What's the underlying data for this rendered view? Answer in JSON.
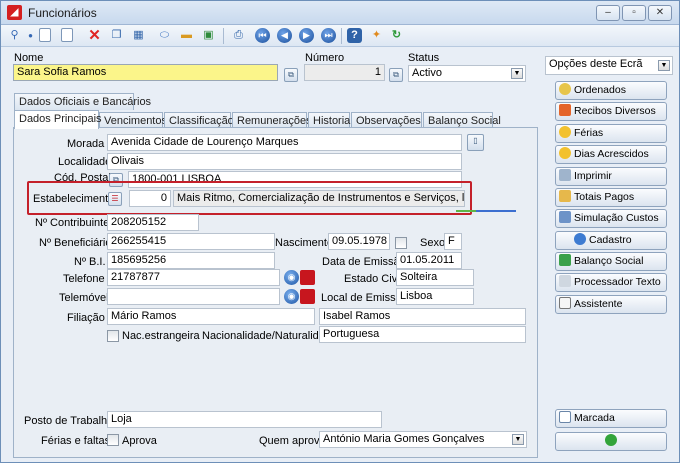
{
  "window": {
    "title": "Funcionários"
  },
  "toolbar": {
    "icons": [
      "search-icon",
      "new-icon",
      "document-icon",
      "delete-icon",
      "copy-icon",
      "table-icon",
      "link-icon",
      "folder-icon",
      "excel-icon",
      "preview-icon",
      "first-icon",
      "previous-icon",
      "next-icon",
      "last-icon",
      "help-icon",
      "tools-icon",
      "refresh-icon"
    ]
  },
  "header": {
    "nome_label": "Nome",
    "nome_value": "Sara Sofia Ramos",
    "numero_label": "Número",
    "numero_value": "1",
    "status_label": "Status",
    "status_value": "Activo"
  },
  "tabs_top": [
    "Dados Oficiais e Bancários"
  ],
  "tabs": [
    "Dados Principais",
    "Vencimentos",
    "Classificação",
    "Remunerações",
    "Historial",
    "Observações",
    "Balanço Social"
  ],
  "form": {
    "morada_label": "Morada",
    "morada_value": "Avenida Cidade de Lourenço Marques",
    "localidade_label": "Localidade",
    "localidade_value": "Olivais",
    "cod_postal_label": "Cód. Postal",
    "cod_postal_value": "1800-001 LISBOA",
    "estabelecimento_label": "Estabelecimento",
    "estabelecimento_num": "0",
    "estabelecimento_value": "Mais Ritmo, Comercialização de Instrumentos e Serviços, lda",
    "contribuinte_label": "Nº Contribuinte",
    "contribuinte_value": "208205152",
    "beneficiario_label": "Nº Beneficiário",
    "beneficiario_value": "266255415",
    "nascimento_label": "Nascimento",
    "nascimento_value": "09.05.1978",
    "sexo_label": "Sexo",
    "sexo_value": "F",
    "bi_label": "Nº B.I.",
    "bi_value": "185695256",
    "emissao_label": "Data de Emissão",
    "emissao_value": "01.05.2011",
    "telefone_label": "Telefone",
    "telefone_value": "21787877",
    "estado_civil_label": "Estado Civil",
    "estado_civil_value": "Solteira",
    "telemovel_label": "Telemóvel",
    "telemovel_value": "",
    "local_emissao_label": "Local de Emissão",
    "local_emissao_value": "Lisboa",
    "filiacao_label": "Filiação",
    "filiacao_pai": "Mário Ramos",
    "filiacao_mae": "Isabel Ramos",
    "nac_estrangeira_label": "Nac.estrangeira",
    "nacionalidade_label": "Nacionalidade/Naturalidade",
    "nacionalidade_value": "Portuguesa",
    "posto_label": "Posto de Trabalho",
    "posto_value": "Loja",
    "ferias_label": "Férias e faltas",
    "aprova_label": "Aprova",
    "quem_aprova_label": "Quem aprova",
    "quem_aprova_value": "António Maria Gomes Gonçalves"
  },
  "side": {
    "opcoes_label": "Opções deste Ecrã",
    "buttons": [
      "Ordenados",
      "Recibos Diversos",
      "Férias",
      "Dias Acrescidos",
      "Imprimir",
      "Totais Pagos",
      "Simulação Custos",
      "Cadastro",
      "Balanço Social",
      "Processador Texto",
      "Assistente"
    ],
    "marcada_label": "Marcada"
  },
  "colors": {
    "highlight": "#c4202a",
    "name_field": "#fbf58a"
  }
}
